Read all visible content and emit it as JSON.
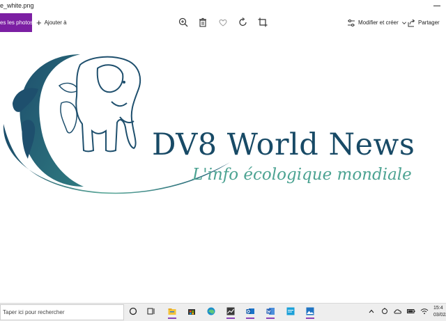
{
  "window": {
    "title": "e_white.png"
  },
  "toolbar": {
    "collection_label": "es les photos",
    "add_label": "Ajouter à",
    "edit_label": "Modifier et créer",
    "share_label": "Partager"
  },
  "logo": {
    "title": "DV8 World News",
    "tagline": "L'info écologique mondiale"
  },
  "taskbar": {
    "search_placeholder": "Taper ici pour rechercher",
    "clock_time": "15:4",
    "clock_date": "03/02/"
  },
  "colors": {
    "accent_purple": "#7c1fa3",
    "logo_navy": "#184a66",
    "logo_teal": "#4ca392"
  }
}
